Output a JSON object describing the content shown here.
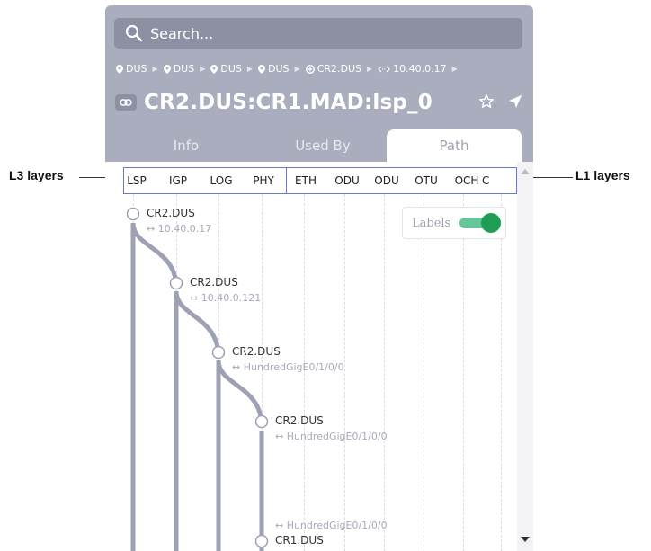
{
  "callouts": {
    "left": "L3 layers",
    "right": "L1 layers"
  },
  "search": {
    "placeholder": "Search..."
  },
  "breadcrumb": {
    "items": [
      "DUS",
      "DUS",
      "DUS",
      "DUS",
      "CR2.DUS",
      "10.40.0.17"
    ]
  },
  "title": "CR2.DUS:CR1.MAD:lsp_0",
  "tabs": [
    {
      "label": "Info"
    },
    {
      "label": "Used By"
    },
    {
      "label": "Path"
    }
  ],
  "layers": [
    "LSP",
    "IGP",
    "LOG",
    "PHY",
    "ETH",
    "ODU",
    "ODU",
    "OTU",
    "OCH",
    "C"
  ],
  "labels_toggle": {
    "label": "Labels",
    "on": true
  },
  "path_nodes": [
    {
      "name": "CR2.DUS",
      "interface": "10.40.0.17"
    },
    {
      "name": "CR2.DUS",
      "interface": "10.40.0.121"
    },
    {
      "name": "CR2.DUS",
      "interface": "HundredGigE0/1/0/0"
    },
    {
      "name": "CR2.DUS",
      "interface": "HundredGigE0/1/0/0"
    },
    {
      "name": "CR1.DUS",
      "interface": "HundredGigE0/1/0/0"
    }
  ],
  "colors": {
    "header": "#a9adbd",
    "search_bg": "#8c90a2",
    "path_line": "#9da1b3",
    "toggle_on": "#1f9d55",
    "layers_border": "#6a7bc2"
  },
  "icons": {
    "search": "search-icon",
    "location": "location-pin-icon",
    "router": "router-icon",
    "interface": "interface-arrows-icon",
    "link": "link-icon",
    "star": "star-icon",
    "navigate": "navigate-icon"
  }
}
